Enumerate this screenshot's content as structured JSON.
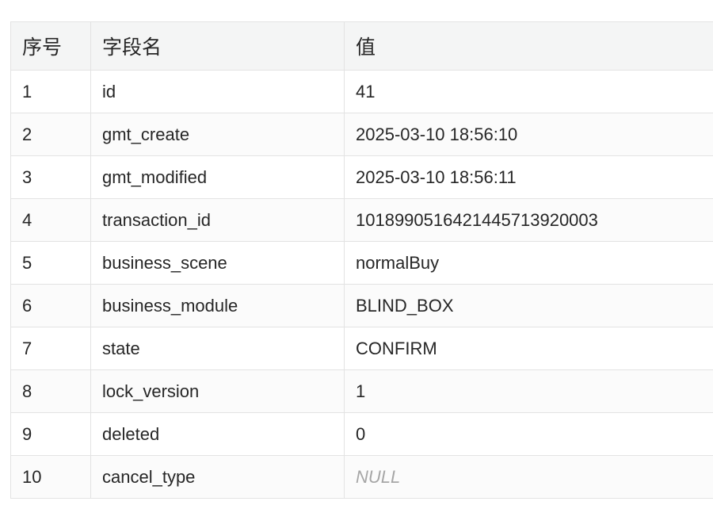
{
  "table": {
    "headers": [
      "序号",
      "字段名",
      "值"
    ],
    "rows": [
      {
        "index": "1",
        "field": "id",
        "value": "41"
      },
      {
        "index": "2",
        "field": "gmt_create",
        "value": "2025-03-10 18:56:10"
      },
      {
        "index": "3",
        "field": "gmt_modified",
        "value": "2025-03-10 18:56:11"
      },
      {
        "index": "4",
        "field": "transaction_id",
        "value": "1018990516421445713920003"
      },
      {
        "index": "5",
        "field": "business_scene",
        "value": "normalBuy"
      },
      {
        "index": "6",
        "field": "business_module",
        "value": "BLIND_BOX"
      },
      {
        "index": "7",
        "field": "state",
        "value": "CONFIRM"
      },
      {
        "index": "8",
        "field": "lock_version",
        "value": "1"
      },
      {
        "index": "9",
        "field": "deleted",
        "value": "0"
      },
      {
        "index": "10",
        "field": "cancel_type",
        "value": "NULL"
      }
    ]
  },
  "colors": {
    "header_bg": "#f4f5f5",
    "border": "#e3e3e3",
    "text": "#262626",
    "null_text": "#a6a6a6"
  }
}
